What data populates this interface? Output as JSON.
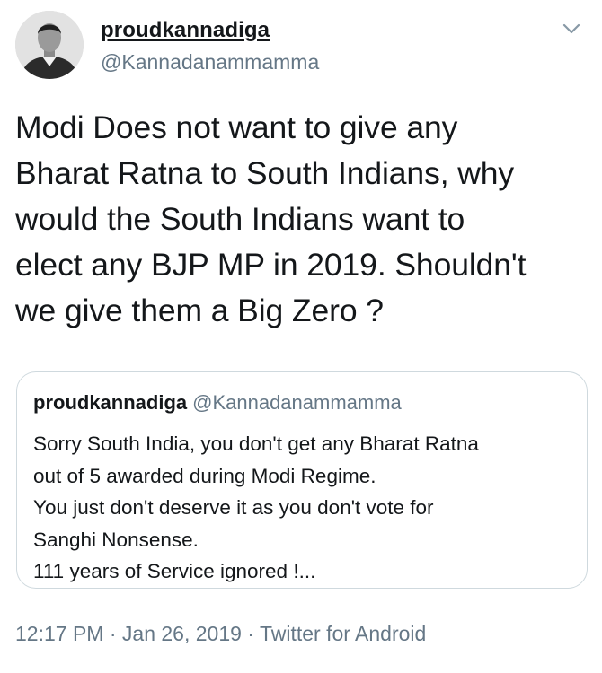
{
  "author": {
    "display_name": "proudkannadiga",
    "handle": "@Kannadanammamma"
  },
  "tweet": {
    "text": "Modi Does not want to give any\nBharat Ratna to South Indians, why\nwould the South Indians want to\nelect any BJP MP in 2019. Shouldn't\nwe give them a Big Zero ?"
  },
  "quoted_tweet": {
    "display_name": "proudkannadiga",
    "handle": "@Kannadanammamma",
    "text": "Sorry South India, you don't get any Bharat Ratna\nout of 5 awarded during Modi Regime.\nYou just don't deserve it as you don't vote for\nSanghi Nonsense.\n111 years of Service ignored !..."
  },
  "meta": {
    "time": "12:17 PM",
    "date": "Jan 26, 2019",
    "source": "Twitter for Android",
    "separator": " · "
  },
  "icons": {
    "avatar": "user-photo",
    "caret": "chevron-down-icon"
  }
}
